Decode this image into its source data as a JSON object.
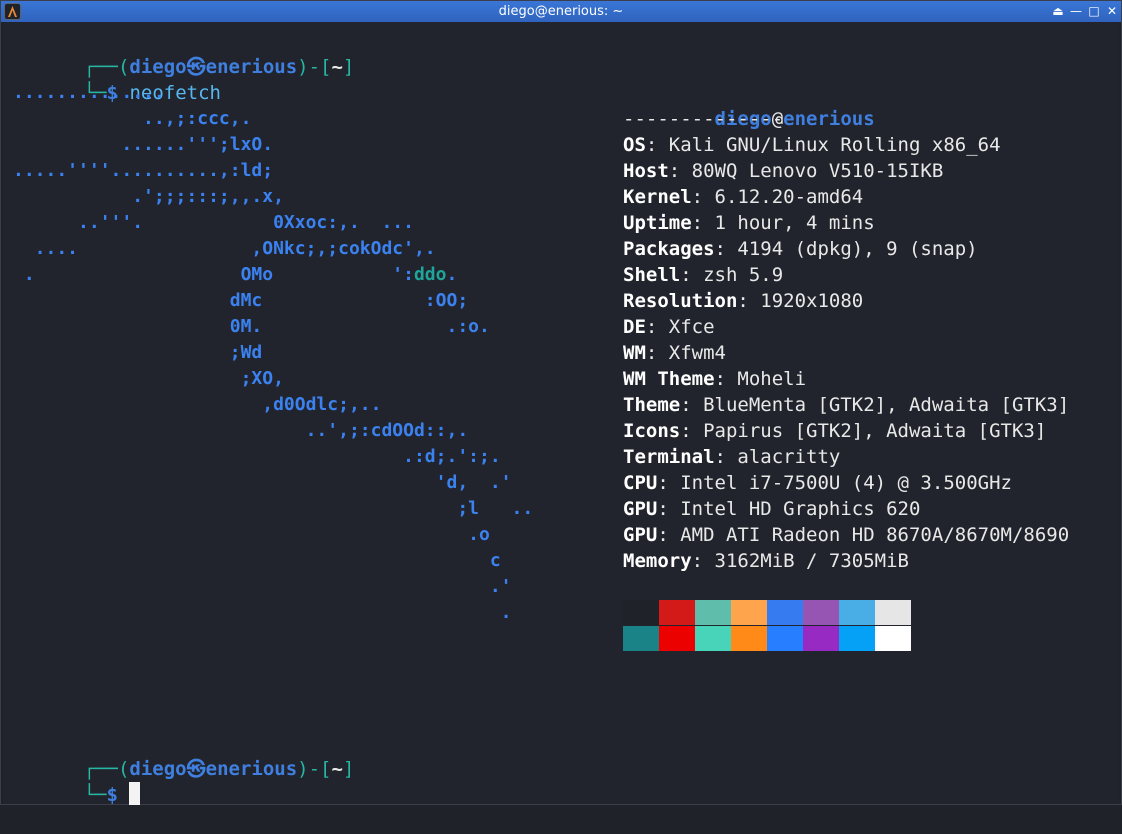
{
  "window": {
    "title": "diego@enerious: ~",
    "buttons": [
      "⏏",
      "—",
      "□",
      "✕"
    ]
  },
  "prompt1": {
    "bracket_open": "┌──(",
    "user": "diego",
    "sep": "㉿",
    "host": "enerious",
    "mid": ")-[",
    "dir": "~",
    "close": "]",
    "corner": "└─",
    "symbol": "$",
    "command": "neofetch"
  },
  "art": [
    "..............",
    "            ..,;:ccc,.",
    "          ......''';lxO.",
    ".....''''..........,:ld;",
    "           .';;;:::;,,.x,",
    "      ..'''.            0Xxoc:,.  ...",
    "  ....                ,ONkc;,;cokOdc',.",
    " .                   OMo           ':ddo.",
    "                    dMc               :OO;",
    "                    0M.                 .:o.",
    "                    ;Wd",
    "                     ;XO,",
    "                       ,d0Odlc;,..",
    "                           ..',;:cdOOd::,.",
    "                                    .:d;.':;.",
    "                                       'd,  .'",
    "                                         ;l   ..",
    "                                          .o",
    "                                            c",
    "                                            .'",
    "                                             ."
  ],
  "info": {
    "user": "diego",
    "at": "@",
    "host": "enerious",
    "divider": "--------------",
    "rows": [
      {
        "key": "OS",
        "value": "Kali GNU/Linux Rolling x86_64"
      },
      {
        "key": "Host",
        "value": "80WQ Lenovo V510-15IKB"
      },
      {
        "key": "Kernel",
        "value": "6.12.20-amd64"
      },
      {
        "key": "Uptime",
        "value": "1 hour, 4 mins"
      },
      {
        "key": "Packages",
        "value": "4194 (dpkg), 9 (snap)"
      },
      {
        "key": "Shell",
        "value": "zsh 5.9"
      },
      {
        "key": "Resolution",
        "value": "1920x1080"
      },
      {
        "key": "DE",
        "value": "Xfce"
      },
      {
        "key": "WM",
        "value": "Xfwm4"
      },
      {
        "key": "WM Theme",
        "value": "Moheli"
      },
      {
        "key": "Theme",
        "value": "BlueMenta [GTK2], Adwaita [GTK3]"
      },
      {
        "key": "Icons",
        "value": "Papirus [GTK2], Adwaita [GTK3]"
      },
      {
        "key": "Terminal",
        "value": "alacritty"
      },
      {
        "key": "CPU",
        "value": "Intel i7-7500U (4) @ 3.500GHz"
      },
      {
        "key": "GPU",
        "value": "Intel HD Graphics 620"
      },
      {
        "key": "GPU",
        "value": "AMD ATI Radeon HD 8670A/8670M/8690"
      },
      {
        "key": "Memory",
        "value": "3162MiB / 7305MiB"
      }
    ],
    "palette_top": [
      "#1f2229",
      "#d41919",
      "#5ebdab",
      "#fea44c",
      "#367bf0",
      "#9755b3",
      "#49aee6",
      "#e6e6e6"
    ],
    "palette_bottom": [
      "#198388",
      "#ec0101",
      "#47d4b9",
      "#ff8a18",
      "#277fff",
      "#962ac3",
      "#05a1f7",
      "#ffffff"
    ]
  },
  "prompt2": {
    "bracket_open": "┌──(",
    "user": "diego",
    "sep": "㉿",
    "host": "enerious",
    "mid": ")-[",
    "dir": "~",
    "close": "]",
    "corner": "└─",
    "symbol": "$"
  }
}
